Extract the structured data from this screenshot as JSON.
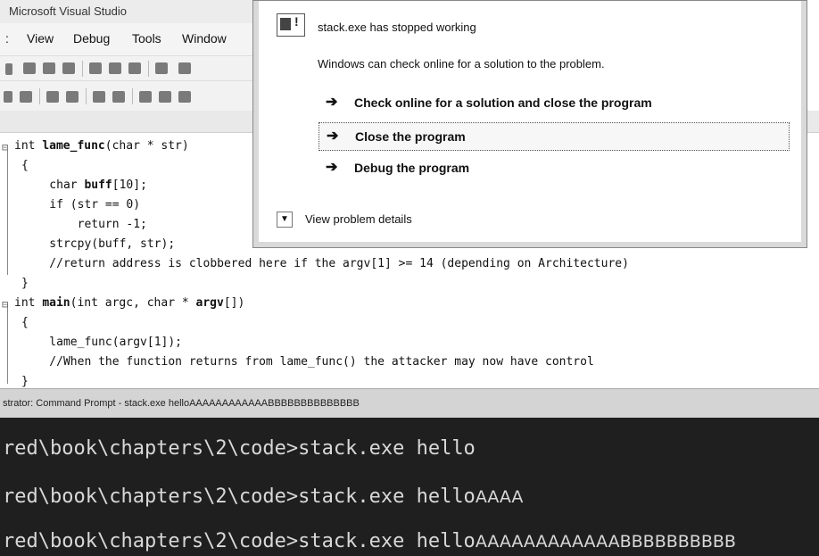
{
  "vs": {
    "window_title": "Microsoft Visual Studio",
    "menu": [
      ":",
      "View",
      "Debug",
      "Tools",
      "Window"
    ]
  },
  "code": [
    {
      "gutter": "⊟",
      "parts": [
        {
          "t": "int ",
          "b": false
        },
        {
          "t": "lame_func",
          "b": true
        },
        {
          "t": "(char * str)",
          "b": false
        }
      ]
    },
    {
      "gutter": "",
      "parts": [
        {
          "t": "{",
          "b": false
        }
      ]
    },
    {
      "gutter": "",
      "parts": [
        {
          "t": "    char ",
          "b": false
        },
        {
          "t": "buff",
          "b": true
        },
        {
          "t": "[10];",
          "b": false
        }
      ]
    },
    {
      "gutter": "",
      "parts": [
        {
          "t": "    if (str == 0)",
          "b": false
        }
      ]
    },
    {
      "gutter": "",
      "parts": [
        {
          "t": "        return -1;",
          "b": false
        }
      ]
    },
    {
      "gutter": "",
      "parts": [
        {
          "t": "    strcpy(buff, str);",
          "b": false
        }
      ]
    },
    {
      "gutter": "",
      "parts": [
        {
          "t": "    //return address is clobbered here if the argv[1] >= 14 (depending on Architecture)",
          "b": false
        }
      ]
    },
    {
      "gutter": "",
      "parts": [
        {
          "t": "}",
          "b": false
        }
      ]
    },
    {
      "gutter": "⊟",
      "parts": [
        {
          "t": "int ",
          "b": false
        },
        {
          "t": "main",
          "b": true
        },
        {
          "t": "(int argc, char * ",
          "b": false
        },
        {
          "t": "argv",
          "b": true
        },
        {
          "t": "[])",
          "b": false
        }
      ]
    },
    {
      "gutter": "",
      "parts": [
        {
          "t": "{",
          "b": false
        }
      ]
    },
    {
      "gutter": "",
      "parts": [
        {
          "t": "    lame_func(argv[1]);",
          "b": false
        }
      ]
    },
    {
      "gutter": "",
      "parts": [
        {
          "t": "    //When the function returns from lame_func() the attacker may now have control",
          "b": false
        }
      ]
    },
    {
      "gutter": "",
      "parts": [
        {
          "t": "}",
          "b": false
        }
      ]
    }
  ],
  "dialog": {
    "title": "stack.exe has stopped working",
    "description": "Windows can check online for a solution to the problem.",
    "options": [
      {
        "label": "Check online for a solution and close the program",
        "selected": false
      },
      {
        "label": "Close the program",
        "selected": true
      },
      {
        "label": "Debug the program",
        "selected": false
      }
    ],
    "details_label": "View problem details",
    "arrow_glyph": "➔"
  },
  "cmd": {
    "title": "strator: Command Prompt - stack.exe  helloAAAAAAAAAAAABBBBBBBBBBBBBB",
    "lines": [
      {
        "prompt": "red\\book\\chapters\\2\\code>stack.exe hello",
        "arg": ""
      },
      {
        "prompt": "red\\book\\chapters\\2\\code>stack.exe hello",
        "arg": "AAAA"
      },
      {
        "prompt": "red\\book\\chapters\\2\\code>stack.exe hello",
        "arg": "AAAAAAAAAAAABBBBBBBBBB"
      }
    ]
  }
}
